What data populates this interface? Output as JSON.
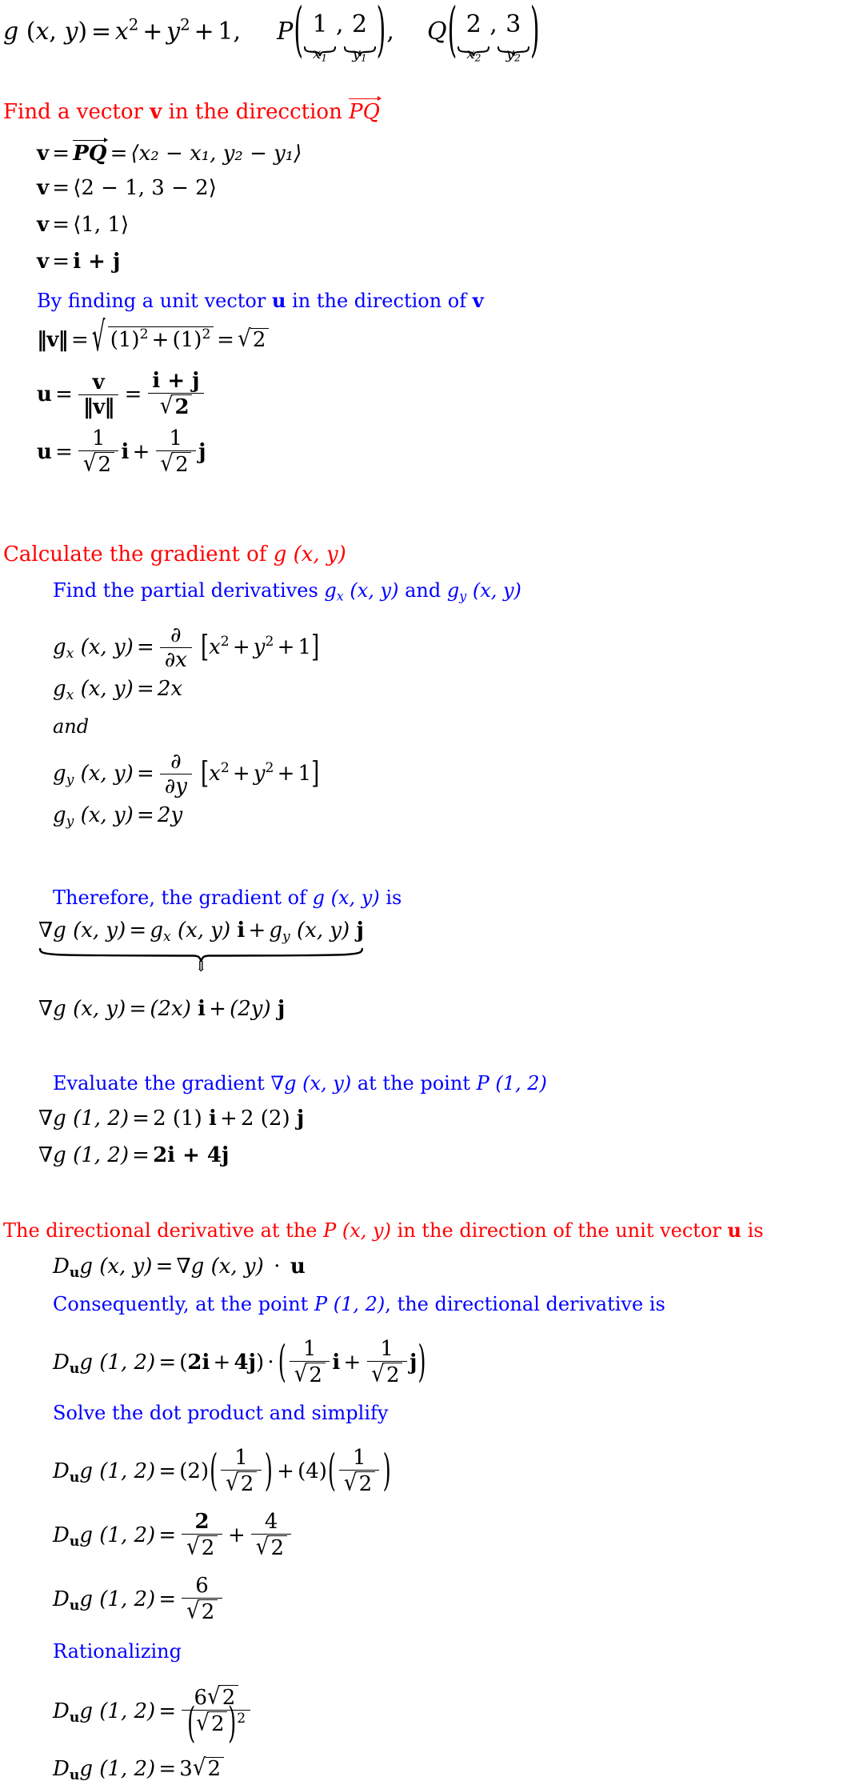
{
  "document": {
    "type": "math-worked-solution",
    "topic": "Directional derivative of g(x,y) = x^2 + y^2 + 1 at P(1,2) in the direction of PQ",
    "colors": {
      "heading_red": "#ff0000",
      "subheading_blue": "#0000ff",
      "body_black": "#000000",
      "background": "#ffffff"
    }
  },
  "problem": {
    "function_lhs": "g",
    "function_args": "(x, y)",
    "equals": "=",
    "function_rhs_x2": "x",
    "exp2": "2",
    "plus": "+",
    "function_rhs_y2": "y",
    "one": "1",
    "comma": ",",
    "point_P_label": "P",
    "point_P_x_value": "1",
    "point_P_x_name": "x",
    "point_P_x_index": "1",
    "point_P_y_value": "2",
    "point_P_y_name": "y",
    "point_P_y_index": "1",
    "point_Q_label": "Q",
    "point_Q_x_value": "2",
    "point_Q_x_name": "x",
    "point_Q_x_index": "2",
    "point_Q_y_value": "3",
    "point_Q_y_name": "y",
    "point_Q_y_index": "2"
  },
  "step1": {
    "heading": {
      "before_v": "Find a vector",
      "v_symbol": "v",
      "after_v": "in the direcction",
      "pq": "PQ"
    },
    "lines": [
      {
        "id": "v-equals-pq-components",
        "lhs": "v",
        "eq1": "=",
        "vec": "PQ",
        "eq2": "=",
        "components": "⟨x₂ − x₁, y₂ − y₁⟩"
      },
      {
        "id": "v-numeric-components",
        "lhs": "v",
        "eq1": "=",
        "components": "⟨2 − 1, 3 − 2⟩"
      },
      {
        "id": "v-simplified-components",
        "lhs": "v",
        "eq1": "=",
        "components": "⟨1, 1⟩"
      },
      {
        "id": "v-ij-form",
        "lhs": "v",
        "eq1": "=",
        "components": "i + j"
      }
    ]
  },
  "step2": {
    "heading": {
      "before_u": "By finding a unit vector",
      "u_symbol": "u",
      "after_u": "in the direction of",
      "v_symbol": "v"
    },
    "norm_lhs": "‖v‖",
    "norm_eq": "=",
    "norm_radicand_first": "(1)",
    "norm_radicand_exp": "2",
    "norm_plus": "+",
    "norm_radicand_second": "(1)",
    "norm_result_sqrt_of": "2",
    "u_lhs": "u",
    "u_eq1": "=",
    "u_frac_num": "v",
    "u_frac_den": "‖v‖",
    "u_eq2": "=",
    "u_frac2_num": "i + j",
    "u_frac2_den_sqrt": "2",
    "u_expanded_lhs": "u",
    "u_expanded_eq": "=",
    "u_expanded_coeff_num": "1",
    "u_expanded_coeff_den_sqrt": "2",
    "u_expanded_i": "i",
    "u_expanded_plus": "+",
    "u_expanded_j": "j"
  },
  "step3": {
    "heading": "Calculate the gradient of",
    "heading_func": "g (x, y)",
    "sub_heading": {
      "text_before": "Find the partial derivatives",
      "gx": "gx (x, y)",
      "and": "and",
      "gy": "gy (x, y)"
    },
    "gx_def_lhs": "gₓ (x, y)",
    "gx_def_eq": "=",
    "partial_symbol": "∂",
    "partial_x_den": "∂x",
    "bracket_expr": "[x² + y² + 1]",
    "gx_result_lhs": "gₓ (x, y)",
    "gx_result_eq": "=",
    "gx_result_rhs": "2x",
    "and_word": "and",
    "gy_def_lhs": "g_y (x, y)",
    "gy_def_eq": "=",
    "partial_y_den": "∂y",
    "gy_result_lhs": "g_y (x, y)",
    "gy_result_eq": "=",
    "gy_result_rhs": "2y"
  },
  "step4": {
    "heading_before": "Therefore, the gradient of",
    "heading_func": "g (x, y)",
    "heading_after": "is",
    "grad_def_lhs": "∇g (x, y)",
    "grad_def_eq": "=",
    "grad_def_rhs": "gₓ (x, y) i + g_y (x, y) j",
    "implies_arrow": "⇓",
    "grad_result_lhs": "∇g (x, y)",
    "grad_result_eq": "=",
    "grad_result_rhs": "(2x) i + (2y) j"
  },
  "step5": {
    "heading_before": "Evaluate the gradient",
    "heading_grad": "∇g (x, y)",
    "heading_middle": "at the point",
    "heading_point": "P (1, 2)",
    "eval_lhs": "∇g (1, 2)",
    "eval_eq": "=",
    "eval_rhs": "2 (1) i + 2 (2) j",
    "eval_final_lhs": "∇g (1, 2)",
    "eval_final_eq": "=",
    "eval_final_rhs": "2i + 4j"
  },
  "step6": {
    "heading_part1": "The directional derivative at the",
    "heading_point": "P (x, y)",
    "heading_part2": "in the direction of the unit vector",
    "heading_u": "u",
    "heading_part3": "is",
    "formula_lhs": "D_u g (x, y)",
    "formula_eq": "=",
    "formula_rhs": "∇g (x, y) · u",
    "consequently": {
      "part1": "Consequently, at the point",
      "point": "P (1, 2)",
      "comma": ",",
      "part2": "the directional derivative is"
    },
    "dot_lhs": "D_u g (1, 2)",
    "dot_eq": "=",
    "dot_left_factor": "(2i + 4j)",
    "dot_operator": "·",
    "dot_frac_num": "1",
    "dot_frac_den_sqrt": "2",
    "dot_i": "i",
    "dot_plus": "+",
    "dot_j": "j",
    "solve_label": "Solve the dot product and simplify",
    "expand_lhs": "D_u g (1, 2)",
    "expand_eq": "=",
    "expand_two": "(2)",
    "expand_four": "(4)",
    "expand_plus": "+",
    "expand_frac_num": "1",
    "expand_frac_den_sqrt": "2",
    "sum_lhs": "D_u g (1, 2)",
    "sum_eq": "=",
    "sum_frac1_num": "2",
    "sum_frac1_den_sqrt": "2",
    "sum_plus": "+",
    "sum_frac2_num": "4",
    "sum_frac2_den_sqrt": "2",
    "combined_lhs": "D_u g (1, 2)",
    "combined_eq": "=",
    "combined_num": "6",
    "combined_den_sqrt": "2",
    "rationalizing_label": "Rationalizing",
    "rational_lhs": "D_u g (1, 2)",
    "rational_eq": "=",
    "rational_num_coeff": "6",
    "rational_num_sqrt": "2",
    "rational_den_sqrt": "2",
    "rational_den_exp": "2",
    "final_lhs": "D_u g (1, 2)",
    "final_eq": "=",
    "final_coeff": "3",
    "final_sqrt": "2"
  },
  "symbols": {
    "nabla": "∇",
    "partial": "∂",
    "sqrt": "√",
    "dot": "·",
    "angle_open": "⟨",
    "angle_close": "⟩",
    "double_down_arrow": "⇓",
    "minus": "−",
    "norm_bar": "‖"
  }
}
